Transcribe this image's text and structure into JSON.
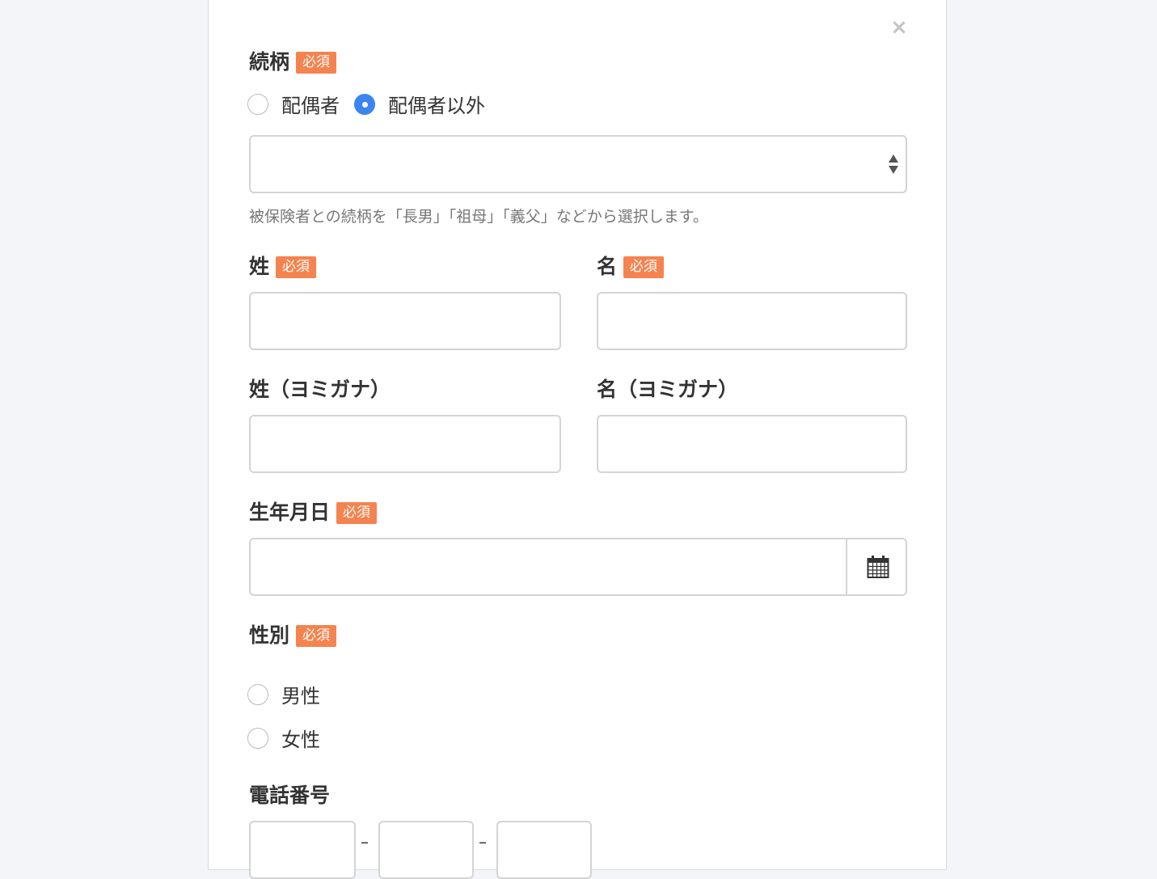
{
  "form": {
    "close_icon": "×",
    "required_badge": "必須",
    "relationship": {
      "label": "続柄",
      "options": [
        "配偶者",
        "配偶者以外"
      ],
      "selected": "配偶者以外",
      "select_value": "",
      "help": "被保険者との続柄を「長男」「祖母」「義父」などから選択します。"
    },
    "last_name": {
      "label": "姓",
      "value": ""
    },
    "first_name": {
      "label": "名",
      "value": ""
    },
    "last_name_kana": {
      "label": "姓（ヨミガナ）",
      "value": ""
    },
    "first_name_kana": {
      "label": "名（ヨミガナ）",
      "value": ""
    },
    "birthdate": {
      "label": "生年月日",
      "value": "",
      "icon": "calendar-icon"
    },
    "gender": {
      "label": "性別",
      "options": [
        "男性",
        "女性"
      ]
    },
    "phone": {
      "label": "電話番号",
      "separator": "–"
    }
  },
  "colors": {
    "required_badge": "#f5834f",
    "radio_checked": "#3c85f0",
    "input_border": "#d4d4d4",
    "background": "#f3f5f9"
  }
}
